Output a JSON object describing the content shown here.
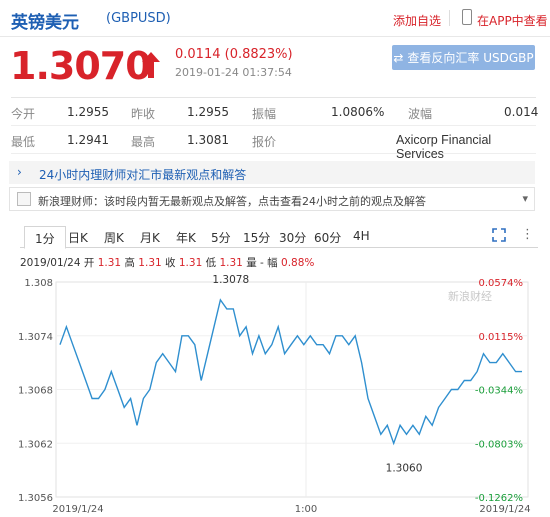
{
  "header": {
    "name": "英镑美元",
    "code": "(GBPUSD)",
    "add_fav": "添加自选",
    "app_view": "在APP中查看"
  },
  "quote": {
    "price": "1.3070",
    "change": "0.0114 (0.8823%)",
    "time": "2019-01-24 01:37:54",
    "reverse_button": "查看反向汇率 USDGBP",
    "colors": {
      "up": "#d8232a",
      "link": "#1e5fb3"
    }
  },
  "stats": {
    "open_label": "今开",
    "open": "1.2955",
    "prev_close_label": "昨收",
    "prev_close": "1.2955",
    "amplitude_label": "振幅",
    "amplitude": "1.0806%",
    "volatility_label": "波幅",
    "volatility": "0.014",
    "low_label": "最低",
    "low": "1.2941",
    "high_label": "最高",
    "high": "1.3081",
    "quote_label": "报价",
    "quote_source": "Axicorp Financial Services"
  },
  "news": {
    "title": "24小时内理财师对汇市最新观点和解答",
    "message": "新浪理财师：该时段内暂无最新观点及解答，点击查看24小时之前的观点及解答"
  },
  "tabs": [
    "1分",
    "日K",
    "周K",
    "月K",
    "年K",
    "5分",
    "15分",
    "30分",
    "60分",
    "4H"
  ],
  "ohlc_bar": {
    "date": "2019/01/24",
    "open_label": "开",
    "open": "1.31",
    "high_label": "高",
    "high": "1.31",
    "close_label": "收",
    "close": "1.31",
    "low_label": "低",
    "low": "1.31",
    "volume_label": "量",
    "volume": "-",
    "amplitude_label": "幅",
    "amplitude": "0.88%"
  },
  "chart_data": {
    "type": "line",
    "y_ticks_left": [
      "1.308",
      "1.3074",
      "1.3068",
      "1.3062",
      "1.3056"
    ],
    "y_ticks_right": [
      "0.0574%",
      "0.0115%",
      "-0.0344%",
      "-0.0803%",
      "-0.1262%"
    ],
    "x_ticks": [
      "2019/1/24",
      "1:00",
      "2019/1/24"
    ],
    "ylim": [
      1.3056,
      1.308
    ],
    "annotations": {
      "max": "1.3078",
      "min": "1.3060"
    },
    "watermark": "新浪财经",
    "series": [
      {
        "values": [
          1.3073,
          1.3075,
          1.3073,
          1.3071,
          1.3069,
          1.3067,
          1.3067,
          1.3068,
          1.307,
          1.3068,
          1.3066,
          1.3067,
          1.3064,
          1.3067,
          1.3068,
          1.3071,
          1.3072,
          1.3071,
          1.307,
          1.3074,
          1.3074,
          1.3073,
          1.3069,
          1.3072,
          1.3075,
          1.3078,
          1.3077,
          1.3077,
          1.3074,
          1.3075,
          1.3072,
          1.3074,
          1.3072,
          1.3073,
          1.3075,
          1.3072,
          1.3073,
          1.3074,
          1.3073,
          1.3074,
          1.3073,
          1.3073,
          1.3072,
          1.3074,
          1.3074,
          1.3073,
          1.3074,
          1.3071,
          1.3067,
          1.3065,
          1.3063,
          1.3064,
          1.3062,
          1.3064,
          1.3063,
          1.3064,
          1.3063,
          1.3065,
          1.3064,
          1.3066,
          1.3067,
          1.3068,
          1.3068,
          1.3069,
          1.3069,
          1.307,
          1.3072,
          1.3071,
          1.3071,
          1.3072,
          1.3071,
          1.307,
          1.307
        ]
      }
    ],
    "line_color": "#2f8fcf"
  }
}
